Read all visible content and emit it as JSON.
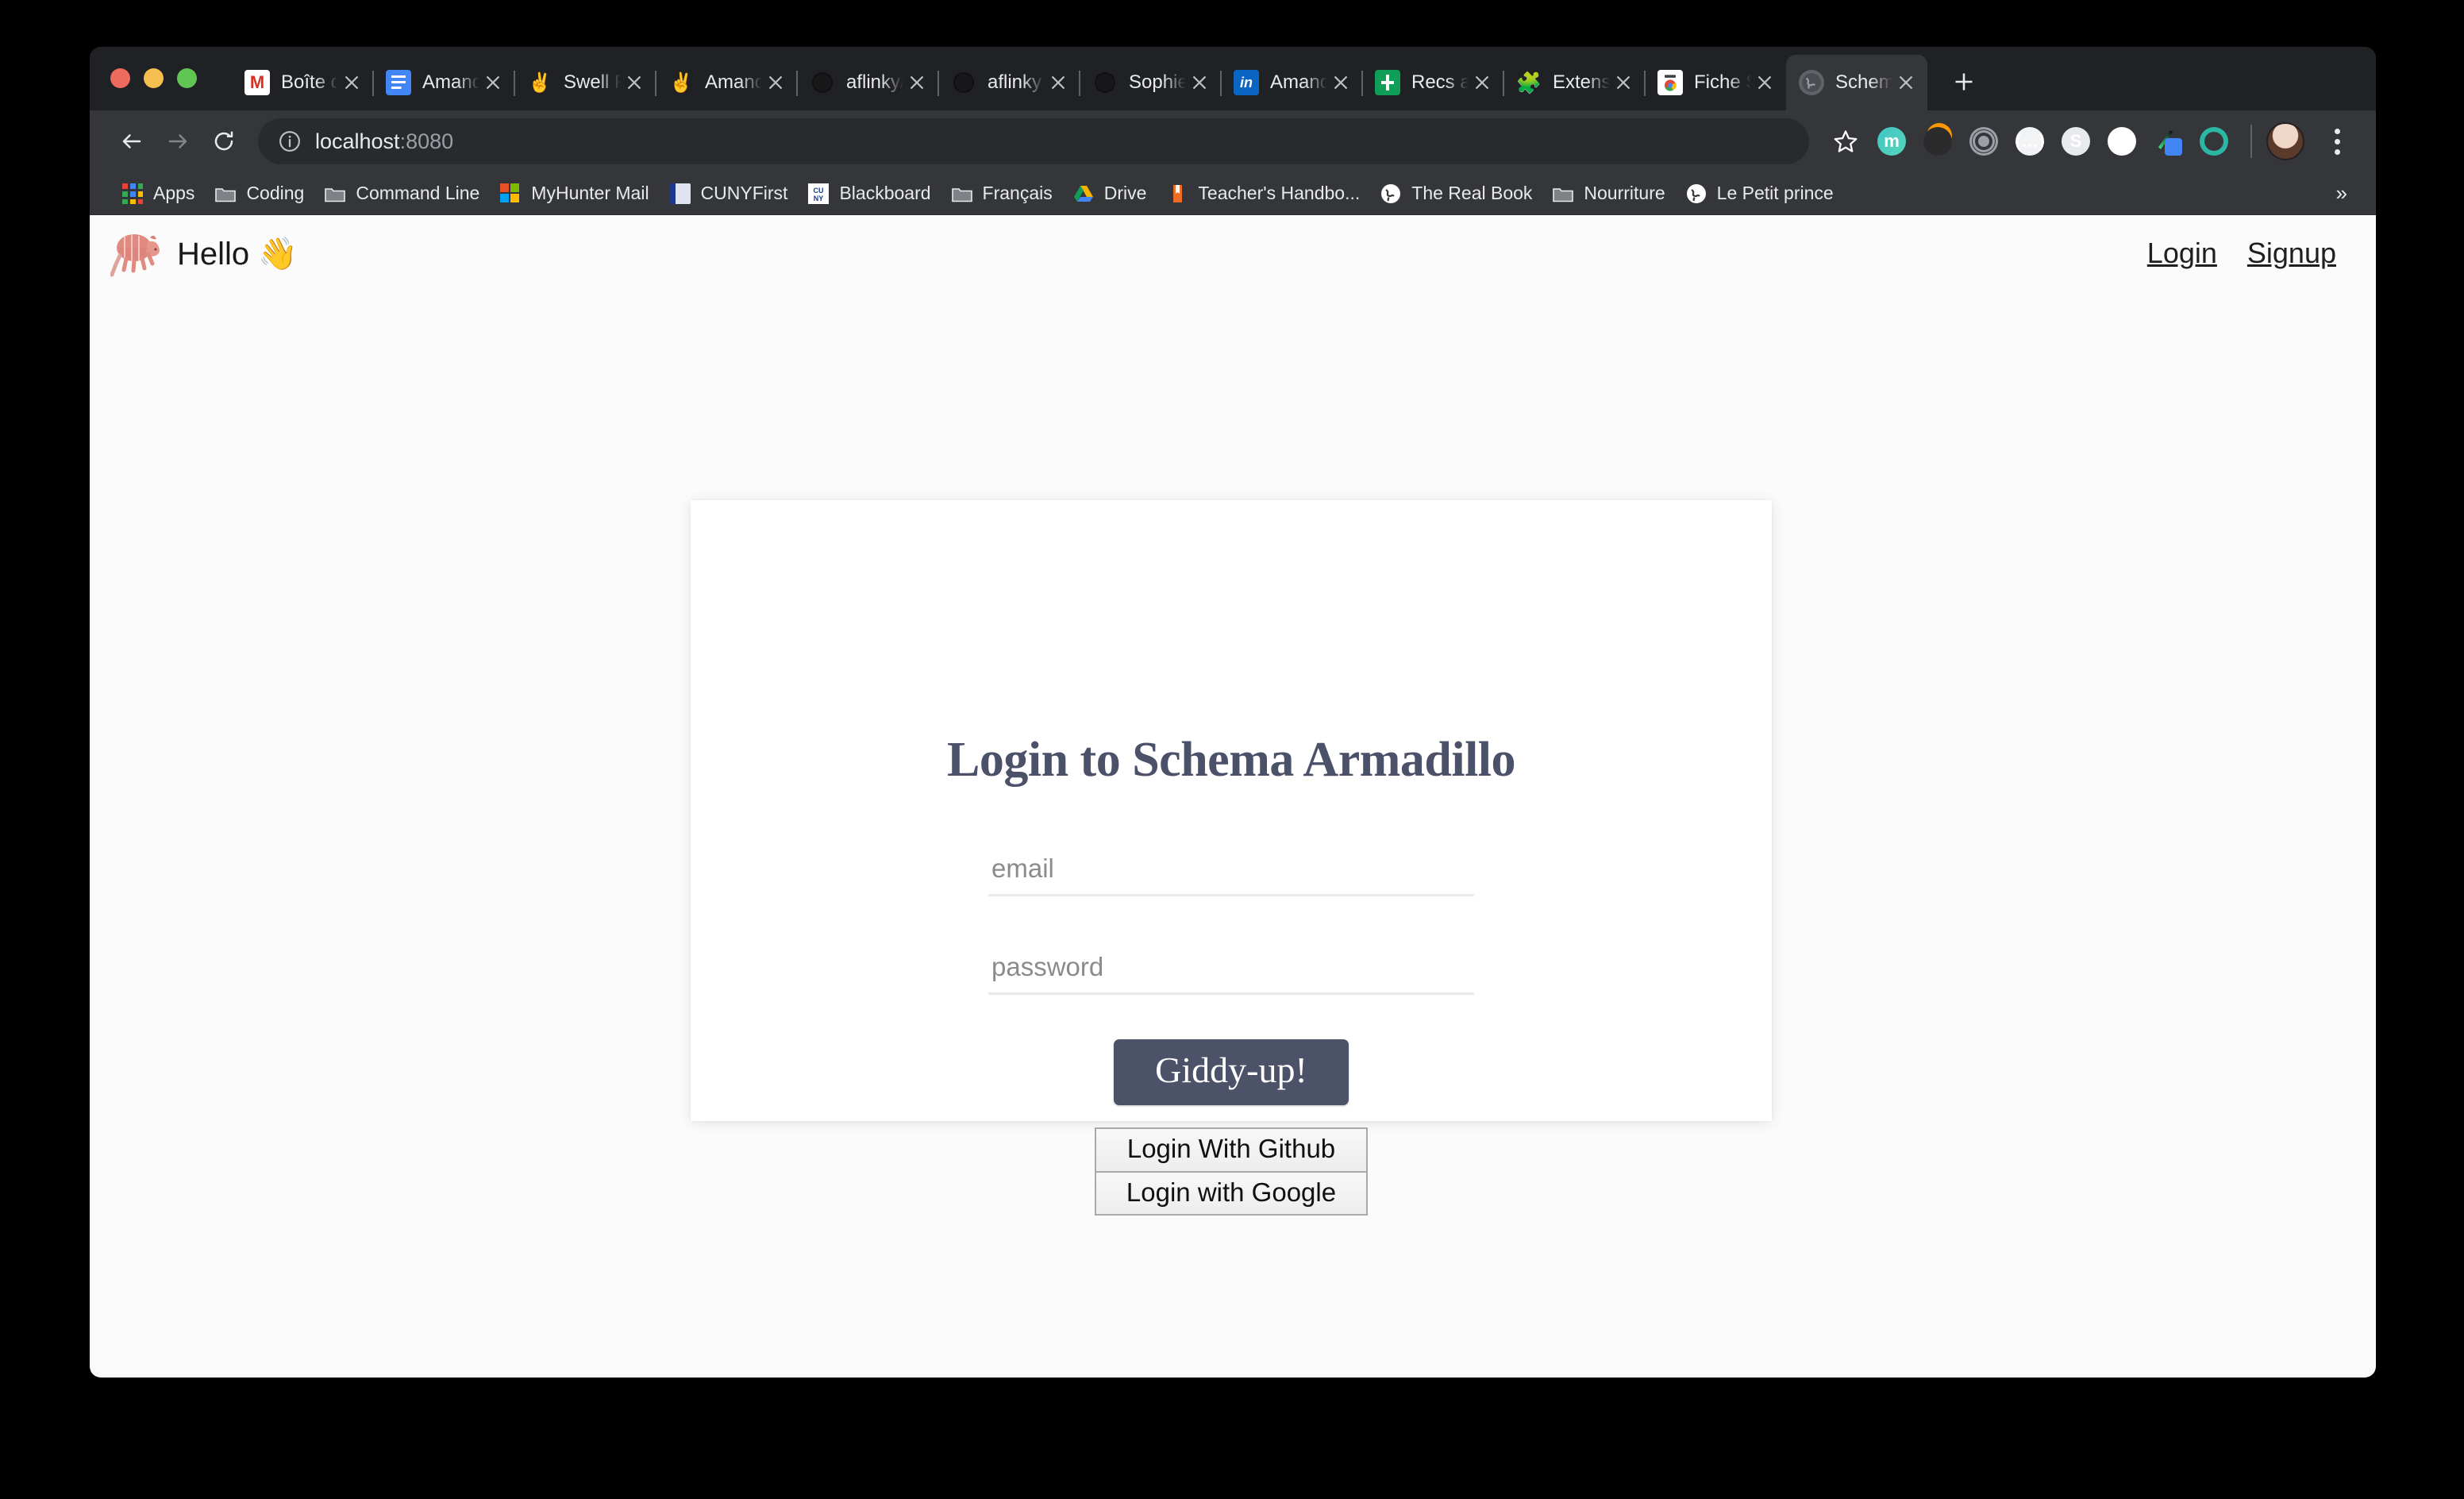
{
  "browser": {
    "traffic_lights": [
      "close",
      "minimize",
      "maximize"
    ],
    "tabs": [
      {
        "title": "Boîte de",
        "favicon": "gmail-icon",
        "glyph": ""
      },
      {
        "title": "Amanda",
        "favicon": "google-docs-icon",
        "glyph": ""
      },
      {
        "title": "Swell Pe",
        "favicon": "peace-hand-icon",
        "glyph": "✌"
      },
      {
        "title": "Amanda",
        "favicon": "peace-hand-icon",
        "glyph": "✌"
      },
      {
        "title": "aflinky/a",
        "favicon": "github-icon",
        "glyph": ""
      },
      {
        "title": "aflinky",
        "favicon": "github-icon",
        "glyph": ""
      },
      {
        "title": "SophieM",
        "favicon": "github-icon",
        "glyph": ""
      },
      {
        "title": "Amanda",
        "favicon": "linkedin-icon",
        "glyph": "in"
      },
      {
        "title": "Recs an",
        "favicon": "google-sheets-icon",
        "glyph": ""
      },
      {
        "title": "Extensio",
        "favicon": "puzzle-piece-icon",
        "glyph": "🧩"
      },
      {
        "title": "Fiche S",
        "favicon": "chrome-webstore-icon",
        "glyph": ""
      },
      {
        "title": "Schema",
        "favicon": "globe-icon",
        "glyph": "🌐",
        "active": true
      }
    ],
    "new_tab_label": "+",
    "toolbar": {
      "back_label": "Back",
      "forward_label": "Forward",
      "reload_label": "Reload",
      "url_main": "localhost",
      "url_suffix": ":8080",
      "site_info_label": "View site information",
      "bookmark_label": "Bookmark this page",
      "extensions": [
        {
          "name": "mailtrack-extension-icon",
          "glyph": "m",
          "style": "ic-m"
        },
        {
          "name": "bomb-extension-icon",
          "glyph": "",
          "style": "ic-bomb"
        },
        {
          "name": "target-extension-icon",
          "glyph": "",
          "style": "ic-target"
        },
        {
          "name": "json-viewer-extension-icon",
          "glyph": "{…}",
          "style": "ic-json"
        },
        {
          "name": "sourcegraph-extension-icon",
          "glyph": "S",
          "style": "ic-s"
        },
        {
          "name": "tampermonkey-extension-icon",
          "glyph": "☺",
          "style": "ic-monkey"
        },
        {
          "name": "color-picker-extension-icon",
          "glyph": "",
          "style": "ic-dropper"
        },
        {
          "name": "ring-extension-icon",
          "glyph": "",
          "style": "ic-ring"
        }
      ],
      "profile_label": "Profile",
      "menu_label": "Customize and control Google Chrome"
    },
    "bookmarks": [
      {
        "label": "Apps",
        "icon": "apps-grid-icon",
        "style": "bm-apps"
      },
      {
        "label": "Coding",
        "icon": "folder-icon",
        "style": "bm-folder"
      },
      {
        "label": "Command Line",
        "icon": "folder-icon",
        "style": "bm-folder"
      },
      {
        "label": "MyHunter Mail",
        "icon": "microsoft-icon",
        "style": "bm-ms"
      },
      {
        "label": "CUNYFirst",
        "icon": "cunyfirst-icon",
        "style": "bm-cuny1"
      },
      {
        "label": "Blackboard",
        "icon": "cuny-blackboard-icon",
        "style": "bm-cuny2",
        "glyph": "CU\nNY"
      },
      {
        "label": "Français",
        "icon": "folder-icon",
        "style": "bm-folder"
      },
      {
        "label": "Drive",
        "icon": "google-drive-icon",
        "style": "bm-drive"
      },
      {
        "label": "Teacher's Handbo...",
        "icon": "book-icon",
        "style": "bm-book"
      },
      {
        "label": "The Real Book",
        "icon": "globe-icon",
        "style": "bm-globe"
      },
      {
        "label": "Nourriture",
        "icon": "folder-icon",
        "style": "bm-folder"
      },
      {
        "label": "Le Petit prince",
        "icon": "globe-icon",
        "style": "bm-globe"
      }
    ],
    "bookmarks_overflow": "»"
  },
  "page": {
    "header": {
      "logo": "armadillo-logo",
      "brand_text": "Hello 👋",
      "nav": [
        {
          "label": "Login"
        },
        {
          "label": "Signup"
        }
      ]
    },
    "login_card": {
      "title": "Login to Schema Armadillo",
      "fields": [
        {
          "name": "email-field",
          "type": "text",
          "placeholder": "email",
          "value": ""
        },
        {
          "name": "password-field",
          "type": "password",
          "placeholder": "password",
          "value": ""
        }
      ],
      "submit_label": "Giddy-up!",
      "oauth": [
        {
          "label": "Login With Github"
        },
        {
          "label": "Login with Google"
        }
      ]
    }
  },
  "colors": {
    "chrome_tabstrip": "#202124",
    "chrome_toolbar": "#35363a",
    "page_background": "#fbfbfb",
    "card_background": "#ffffff",
    "title_color": "#4a5169",
    "accent_button": "#4c5268",
    "placeholder": "#8b8b8b",
    "input_underline": "#e9eaec",
    "armadillo_pink": "#e08a80"
  }
}
